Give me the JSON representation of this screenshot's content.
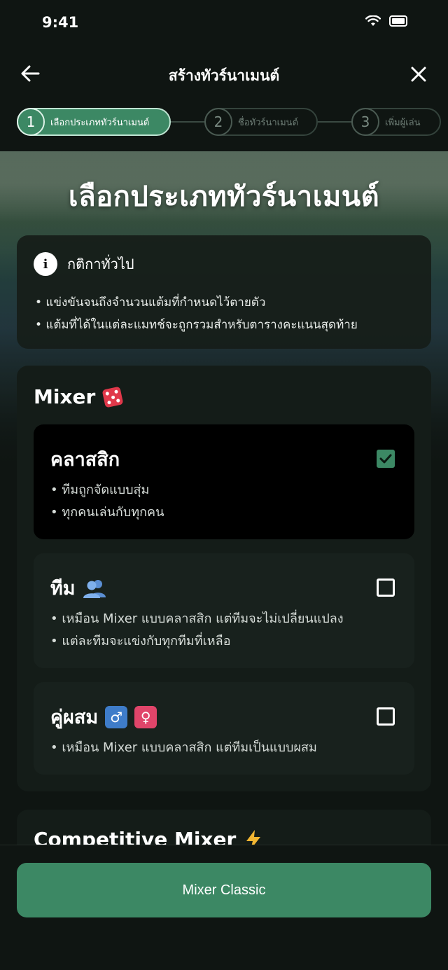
{
  "status_bar": {
    "time": "9:41"
  },
  "header": {
    "title": "สร้างทัวร์นาเมนต์"
  },
  "stepper": [
    {
      "number": "1",
      "label": "เลือกประเภททัวร์นาเมนต์",
      "active": true
    },
    {
      "number": "2",
      "label": "ชื่อทัวร์นาเมนต์",
      "active": false
    },
    {
      "number": "3",
      "label": "เพิ่มผู้เล่น",
      "active": false
    }
  ],
  "hero": {
    "title": "เลือกประเภททัวร์นาเมนต์"
  },
  "rules": {
    "title": "กติกาทั่วไป",
    "items": [
      "• แข่งขันจนถึงจำนวนแต้มที่กำหนดไว้ตายตัว",
      "• แต้มที่ได้ในแต่ละแมทช์จะถูกรวมสำหรับตารางคะแนนสุดท้าย"
    ]
  },
  "mixer_section": {
    "title": "Mixer",
    "options": [
      {
        "title": "คลาสสิก",
        "selected": true,
        "items": [
          "• ทีมถูกจัดแบบสุ่ม",
          "• ทุกคนเล่นกับทุกคน"
        ]
      },
      {
        "title": "ทีม",
        "selected": false,
        "items": [
          "• เหมือน Mixer แบบคลาสสิก แต่ทีมจะไม่เปลี่ยนแปลง",
          "• แต่ละทีมจะแข่งกับทุกทีมที่เหลือ"
        ]
      },
      {
        "title": "คู่ผสม",
        "selected": false,
        "items": [
          "• เหมือน Mixer แบบคลาสสิก แต่ทีมเป็นแบบผสม"
        ]
      }
    ]
  },
  "competitive_section": {
    "title": "Competitive Mixer"
  },
  "cta": {
    "label": "Mixer Classic"
  },
  "colors": {
    "accent": "#3c8864",
    "background": "#0f1512",
    "card": "#141c18"
  }
}
